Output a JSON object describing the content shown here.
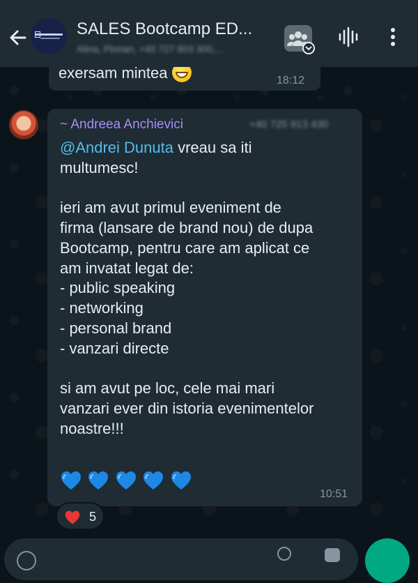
{
  "header": {
    "title": "SALES Bootcamp ED...",
    "subtitle": "Alina, Florian, +40 727 803 300,..."
  },
  "previous_message": {
    "text": "exersam mintea",
    "time": "18:12"
  },
  "message": {
    "sender": "~ Andreea Anchievici",
    "sender_phone": "+40 725 913 430",
    "mention": "@Andrei Dunuta",
    "line1_rest": " vreau sa iti",
    "lines": [
      "multumesc!",
      "",
      "ieri am avut primul eveniment de",
      "firma (lansare de brand nou)  de dupa",
      "Bootcamp, pentru care am aplicat ce",
      "am invatat legat de:",
      "- public speaking",
      "- networking",
      "- personal brand",
      "- vanzari directe",
      "",
      "si am avut pe loc, cele mai mari",
      "vanzari ever din istoria evenimentelor",
      "noastre!!!"
    ],
    "time": "10:51"
  },
  "reaction": {
    "count": "5"
  },
  "colors": {
    "header_bg": "#1f2c34",
    "chat_bg": "#0b141a",
    "bubble_bg": "#1f2c34",
    "sender_name": "#a98cf3",
    "mention": "#53bdeb",
    "heart_blue": "#1e88e5",
    "accent_green": "#00a884"
  }
}
